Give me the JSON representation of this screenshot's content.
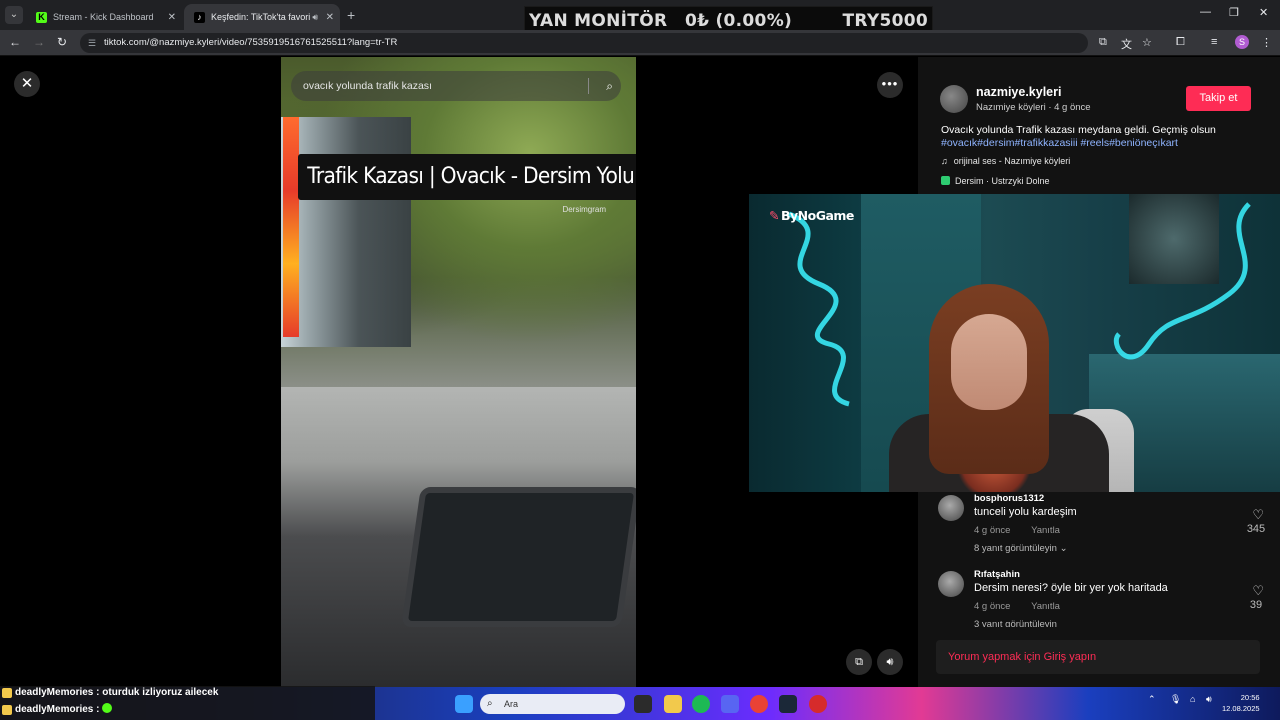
{
  "browser": {
    "tabs": [
      {
        "title": "Stream - Kick Dashboard",
        "active": false
      },
      {
        "title": "Keşfedin: TikTok'ta favori vi",
        "active": true
      }
    ],
    "url": "tiktok.com/@nazmiye.kyleri/video/7535919516761525511?lang=tr-TR"
  },
  "ticker": {
    "label": "YAN MONİTÖR",
    "change": "0₺ (0.00%)",
    "balance": "TRY5000"
  },
  "video": {
    "search_text": "ovacık yolunda trafik kazası",
    "title_overlay": "Trafik Kazası | Ovacık - Dersim Yolu",
    "watermark": "Dersimgram"
  },
  "post": {
    "author_name": "nazmiye.kyleri",
    "author_sub": "Nazımiye köyleri · 4 g önce",
    "follow_label": "Takip et",
    "description": "Ovacık yolunda Trafik kazası meydana geldi. Geçmiş olsun",
    "hashtags": "#ovacık#dersim#trafikkazasiii #reels#beniöneçıkart",
    "music": "orijinal ses - Nazımiye köyleri",
    "location": "Dersim · Ustrzyki Dolne"
  },
  "comments": [
    {
      "user": "bosphorus1312",
      "text": "tunceli yolu kardeşim",
      "time": "4 g önce",
      "reply": "Yanıtla",
      "more": "8 yanıt görüntüleyin",
      "likes": "345"
    },
    {
      "user": "Rıfatşahin",
      "text": "Dersim neresi? öyle bir yer yok haritada",
      "time": "4 g önce",
      "reply": "Yanıtla",
      "more": "3 yanıt görüntüleyin",
      "likes": "39"
    }
  ],
  "login_prompt": "Yorum yapmak için Giriş yapın",
  "webcam": {
    "logo": "ByNoGame"
  },
  "chat": [
    {
      "user": "deadlyMemories",
      "message": "oturduk izliyoruz ailecek"
    },
    {
      "user": "deadlyMemories",
      "message": ""
    }
  ],
  "taskbar": {
    "search_placeholder": "Ara",
    "time": "20:56",
    "date": "12.08.2025"
  },
  "colors": {
    "follow": "#fe2c55",
    "hashtag": "#8fb4ff",
    "kick_green": "#53fc18"
  }
}
